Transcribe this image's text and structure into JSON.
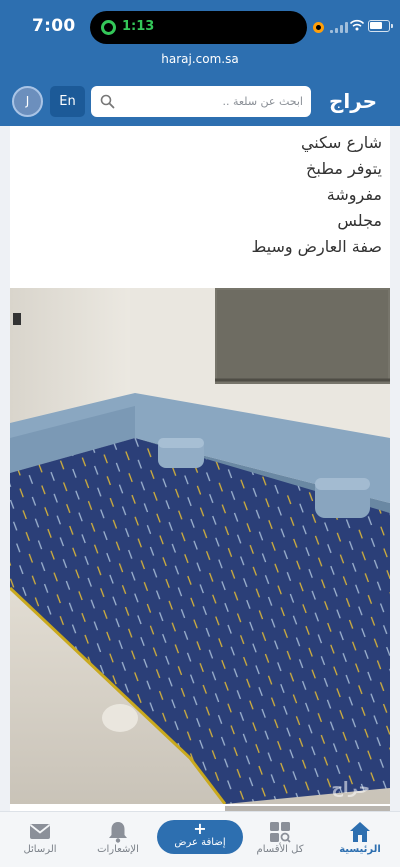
{
  "status_bar": {
    "time": "7:00",
    "call_time": "1:13"
  },
  "browser": {
    "url": "haraj.com.sa"
  },
  "header": {
    "avatar_initial": "J",
    "language_label": "En",
    "search_placeholder": "ابحث عن سلعة ..",
    "logo_text": "حراج"
  },
  "post": {
    "description_lines": [
      "شارع سكني",
      "يتوفر مطبخ",
      "مفروشة",
      "مجلس",
      "صفة العارض وسيط"
    ]
  },
  "bottom_nav": {
    "items": [
      {
        "label": "الرئيسية",
        "icon": "home-icon",
        "active": true
      },
      {
        "label": "كل الأقسام",
        "icon": "categories-icon",
        "active": false
      },
      {
        "label": "الإشعارات",
        "icon": "bell-icon",
        "active": false
      },
      {
        "label": "الرسائل",
        "icon": "mail-icon",
        "active": false
      }
    ],
    "add_button": {
      "plus": "+",
      "label": "إضافة عرض"
    }
  },
  "colors": {
    "brand_blue": "#2d6fb0",
    "active_green": "#34c759",
    "carpet_blue": "#2b3f78",
    "carpet_accent": "#d4b13a"
  }
}
